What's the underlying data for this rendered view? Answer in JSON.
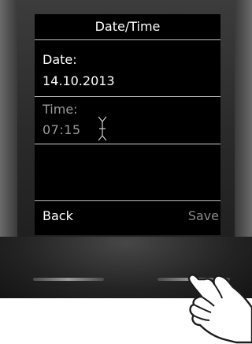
{
  "screen": {
    "title": "Date/Time",
    "date_label": "Date:",
    "date_value": "14.10.2013",
    "time_label": "Time:",
    "time_value": "07:15"
  },
  "softkeys": {
    "left_label": "Back",
    "right_label": "Save"
  },
  "colors": {
    "screen_background": "#000000",
    "active_text": "#ffffff",
    "inactive_text": "#9a9a9a",
    "device_body": "#2a2a2a"
  },
  "icons": {
    "cursor": "text-cursor-icon",
    "hand": "pointing-hand-icon"
  }
}
